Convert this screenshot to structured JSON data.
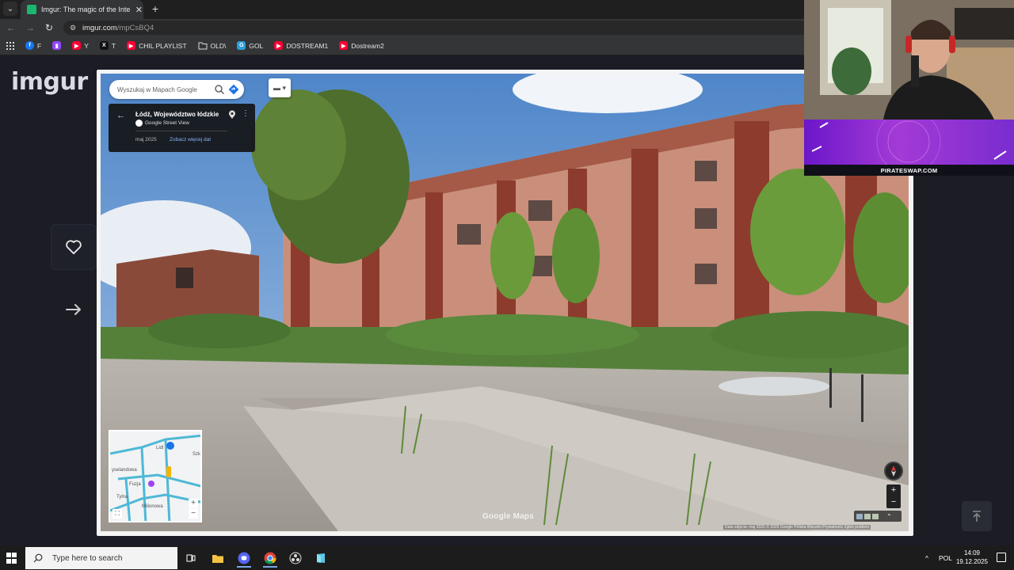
{
  "browser": {
    "tab": {
      "title": "Imgur: The magic of the Internet"
    },
    "url": {
      "domain": "imgur.com",
      "path": "/mpCsBQ4"
    },
    "bookmarks": [
      {
        "label": "F",
        "color": "#1877f2",
        "glyph": "f"
      },
      {
        "label": "",
        "color": "#9146ff",
        "glyph": "▮"
      },
      {
        "label": "Y",
        "color": "#ff0033",
        "glyph": "▶"
      },
      {
        "label": "T",
        "color": "#000000",
        "glyph": "X"
      },
      {
        "label": "CHIL PLAYLIST",
        "color": "#ff0033",
        "glyph": "▶"
      },
      {
        "label": "OLD\\",
        "color": "folder",
        "glyph": ""
      },
      {
        "label": "GOL",
        "color": "#2aa0d8",
        "glyph": "G"
      },
      {
        "label": "DOSTREAM1",
        "color": "#ff0033",
        "glyph": "▶"
      },
      {
        "label": "Dostream2",
        "color": "#ff0033",
        "glyph": "▶"
      }
    ]
  },
  "imgur": {
    "logo": "imgur",
    "accent": "#1bb76e"
  },
  "streetview": {
    "search_placeholder": "Wyszukaj w Mapach Google",
    "location_title": "Łódź, Województwo łódzkie",
    "location_source": "Google Street View",
    "capture_date": "maj 2025",
    "more_dates": "Zobacz więcej dat",
    "watermark": "Google Maps",
    "attribution": "Data zdjęcia: maj 2025   © 2025 Google   Polska   Warunki   Prywatność   Zgłoś problem",
    "minimap_labels": [
      "Lidl",
      "Szk",
      "Fuzja",
      "yselandowa",
      "Tylna",
      "Milionowa"
    ]
  },
  "overlay": {
    "promo": "PIRATESWAP.COM"
  },
  "taskbar": {
    "search_placeholder": "Type here to search",
    "language": "POL",
    "time": "14:09",
    "date": "19.12.2025"
  }
}
